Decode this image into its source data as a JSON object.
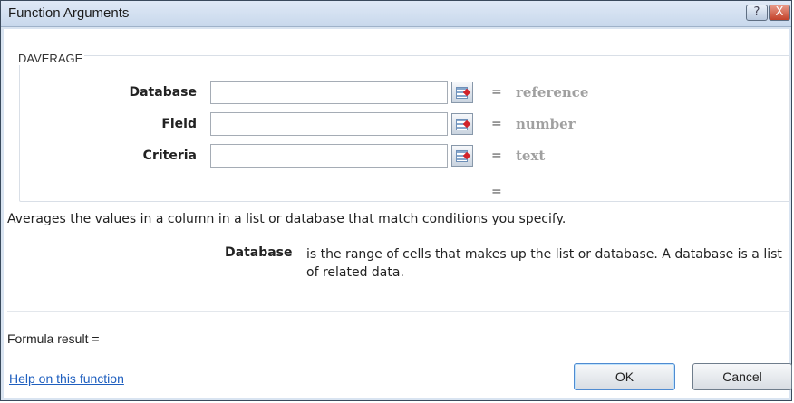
{
  "window": {
    "title": "Function Arguments",
    "help_label": "?",
    "close_label": "X"
  },
  "function": {
    "name": "DAVERAGE",
    "args": [
      {
        "label": "Database",
        "value": "",
        "type": "reference"
      },
      {
        "label": "Field",
        "value": "",
        "type": "number"
      },
      {
        "label": "Criteria",
        "value": "",
        "type": "text"
      }
    ],
    "result_eq": "=",
    "description": "Averages the values in a column in a list or database that match conditions you specify.",
    "param_name": "Database",
    "param_description": "is the range of cells that makes up the list or database. A database is a list of related data."
  },
  "equals": "=",
  "footer": {
    "formula_result": "Formula result =",
    "help_link": "Help on this function",
    "ok_label": "OK",
    "cancel_label": "Cancel"
  },
  "icons": {
    "collapse": "range-select-icon"
  }
}
